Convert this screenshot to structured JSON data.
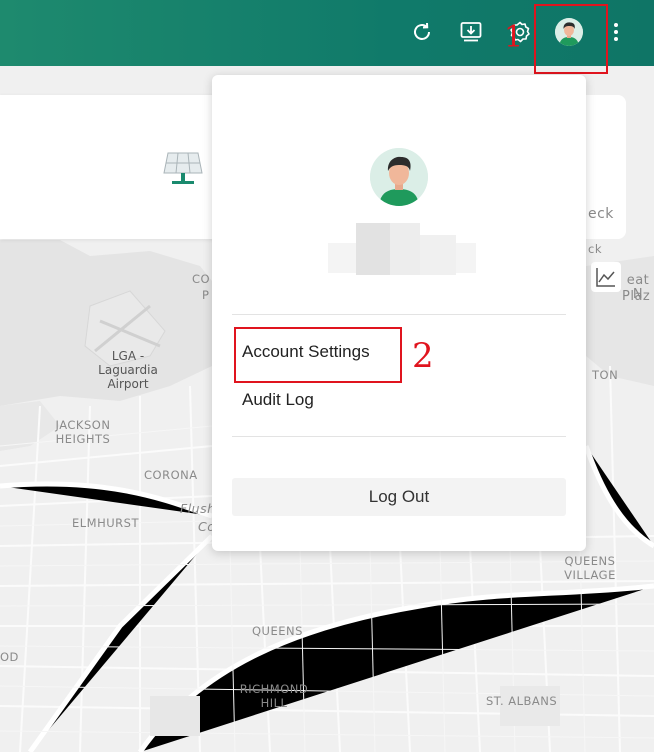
{
  "topbar": {
    "icons": [
      "refresh-icon",
      "download-icon",
      "gear-icon",
      "avatar",
      "more-vertical-icon"
    ],
    "accent": "#117a67"
  },
  "annotations": {
    "step1": "1",
    "step2": "2",
    "color": "#e0141e"
  },
  "map": {
    "labels": {
      "lga": "LGA -\nLaguardia\nAirport",
      "jackson": "JACKSON\nHEIGHTS",
      "corona": "CORONA",
      "elmhurst": "ELMHURST",
      "flush": "Flush",
      "co_italic": "Co",
      "co_top": "CO",
      "p_top": "P",
      "queens": "QUEENS",
      "queens_village": "QUEENS\nVILLAGE",
      "richmond": "RICHMOND\nHILL",
      "st_albans": "ST. ALBANS",
      "od": "OD",
      "ton": "TON",
      "eck": "eck",
      "ck": "ck",
      "great_n": "eat N",
      "plaz": "Plaz"
    }
  },
  "dropdown": {
    "menu": {
      "account_settings": "Account Settings",
      "audit_log": "Audit Log",
      "logout": "Log Out"
    }
  }
}
